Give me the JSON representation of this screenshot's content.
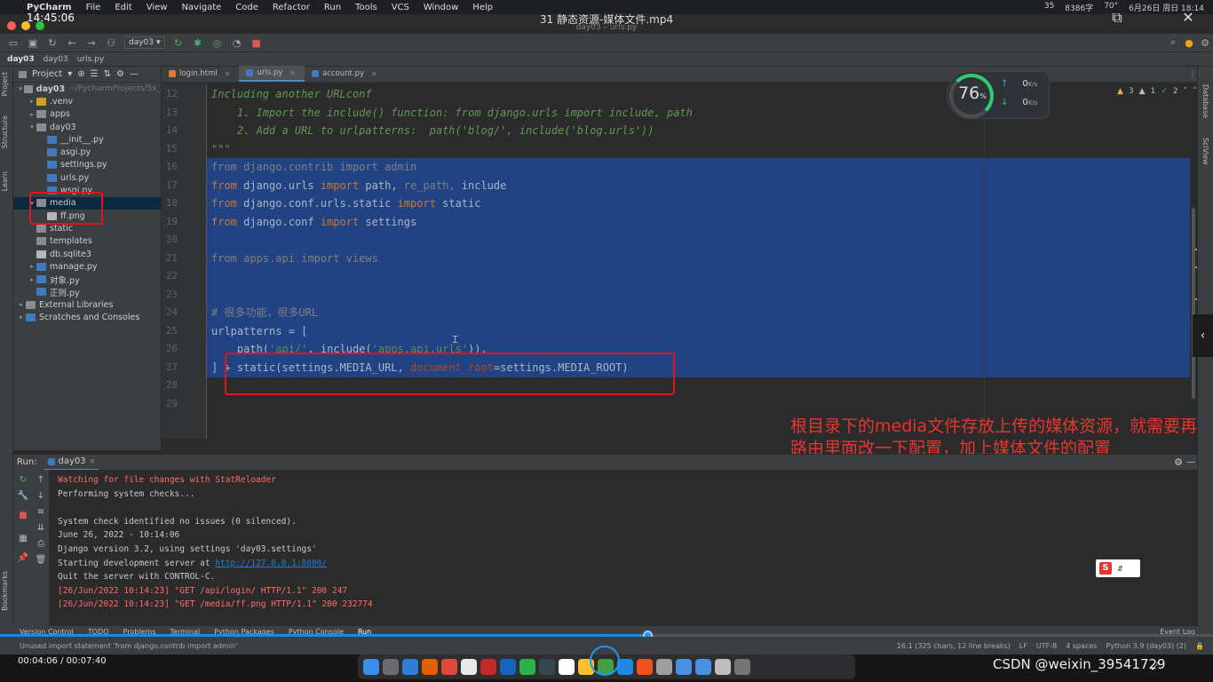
{
  "mac_menu": {
    "app": "PyCharm",
    "items": [
      "File",
      "Edit",
      "View",
      "Navigate",
      "Code",
      "Refactor",
      "Run",
      "Tools",
      "VCS",
      "Window",
      "Help"
    ],
    "status": [
      "35",
      "8386字",
      "70°",
      "6月26日 周日 18:14"
    ]
  },
  "video": {
    "clock": "14:45:06",
    "title": "31 静态资源-媒体文件.mp4",
    "window_title": "day03 – urls.py"
  },
  "toolbar": {
    "run_config": "day03"
  },
  "breadcrumbs": {
    "project": "day03",
    "folder": "day03",
    "file": "urls.py"
  },
  "side_labels": {
    "left": [
      "Project",
      "Structure",
      "Learn",
      "Bookmarks"
    ],
    "right": [
      "Database",
      "SciView"
    ]
  },
  "project_panel": {
    "title": "Project",
    "tree": [
      {
        "indent": 0,
        "arrow": "▾",
        "icon": "folder",
        "label": "day03",
        "extra": "~/PycharmProjects/5x_",
        "bold": true
      },
      {
        "indent": 1,
        "arrow": "▸",
        "icon": "folder-y",
        "label": ".venv"
      },
      {
        "indent": 1,
        "arrow": "▸",
        "icon": "folder",
        "label": "apps"
      },
      {
        "indent": 1,
        "arrow": "▾",
        "icon": "folder",
        "label": "day03"
      },
      {
        "indent": 2,
        "arrow": "",
        "icon": "py",
        "label": "__init__.py"
      },
      {
        "indent": 2,
        "arrow": "",
        "icon": "py",
        "label": "asgi.py"
      },
      {
        "indent": 2,
        "arrow": "",
        "icon": "py",
        "label": "settings.py"
      },
      {
        "indent": 2,
        "arrow": "",
        "icon": "py",
        "label": "urls.py"
      },
      {
        "indent": 2,
        "arrow": "",
        "icon": "py",
        "label": "wsgi.py"
      },
      {
        "indent": 1,
        "arrow": "▾",
        "icon": "folder",
        "label": "media",
        "selected": true
      },
      {
        "indent": 2,
        "arrow": "",
        "icon": "img",
        "label": "ff.png"
      },
      {
        "indent": 1,
        "arrow": "",
        "icon": "folder",
        "label": "static"
      },
      {
        "indent": 1,
        "arrow": "",
        "icon": "folder",
        "label": "templates"
      },
      {
        "indent": 1,
        "arrow": "",
        "icon": "db",
        "label": "db.sqlite3"
      },
      {
        "indent": 1,
        "arrow": "▸",
        "icon": "py",
        "label": "manage.py"
      },
      {
        "indent": 1,
        "arrow": "▸",
        "icon": "py",
        "label": "对象.py"
      },
      {
        "indent": 1,
        "arrow": "",
        "icon": "py",
        "label": "正则.py"
      },
      {
        "indent": 0,
        "arrow": "▸",
        "icon": "lib",
        "label": "External Libraries"
      },
      {
        "indent": 0,
        "arrow": "▸",
        "icon": "scratch",
        "label": "Scratches and Consoles"
      }
    ]
  },
  "editor_tabs": [
    {
      "label": "login.html",
      "color": "#e37933",
      "active": false
    },
    {
      "label": "urls.py",
      "color": "#3f7bbf",
      "active": true
    },
    {
      "label": "account.py",
      "color": "#3f7bbf",
      "active": false
    }
  ],
  "code_lines": [
    {
      "n": "12",
      "html": "<span class='doc'>Including another URLconf</span>"
    },
    {
      "n": "13",
      "html": "<span class='doc'>    1. Import the include() function: from django.urls import include, path</span>"
    },
    {
      "n": "14",
      "html": "<span class='doc'>    2. Add a URL to urlpatterns:  path('blog/', include('blog.urls'))</span>"
    },
    {
      "n": "15",
      "html": "<span class='doc'>\"\"\"</span>"
    },
    {
      "n": "16",
      "html": "<span class='gray'>from django.contrib import admin</span>"
    },
    {
      "n": "17",
      "html": "<span class='kw'>from</span> django.urls <span class='kw'>import</span> path, <span class='gray'>re_path,</span> include"
    },
    {
      "n": "18",
      "html": "<span class='kw'>from</span> django.conf.urls.static <span class='kw'>import</span> static"
    },
    {
      "n": "19",
      "html": "<span class='kw'>from</span> django.conf <span class='kw'>import</span> settings"
    },
    {
      "n": "20",
      "html": ""
    },
    {
      "n": "21",
      "html": "<span class='gray'>from apps.api import views</span>"
    },
    {
      "n": "22",
      "html": ""
    },
    {
      "n": "23",
      "html": ""
    },
    {
      "n": "24",
      "html": "<span class='cmt'># 很多功能，很多URL</span>"
    },
    {
      "n": "25",
      "html": "urlpatterns = ["
    },
    {
      "n": "26",
      "html": "    path(<span class='str'>'api/'</span>, include(<span class='str'>'apps.api.urls'</span>)),"
    },
    {
      "n": "27",
      "html": "] + static(settings.MEDIA_URL, <span class='named'>document_root</span>=settings.MEDIA_ROOT)"
    },
    {
      "n": "28",
      "html": ""
    },
    {
      "n": "29",
      "html": ""
    }
  ],
  "net_widget": {
    "percent": "76",
    "unit": "%",
    "up": "0",
    "down": "0",
    "speed_unit": "K/s"
  },
  "inspections": {
    "warn": "3",
    "weak": "1",
    "typo": "2"
  },
  "annotation": "根目录下的media文件存放上传的媒体资源，就需要再路由里面改一下配置，加上媒体文件的配置",
  "run": {
    "label": "Run:",
    "tab": "day03",
    "console": [
      {
        "text": "Watching for file changes with StatReloader",
        "cls": "red"
      },
      {
        "text": "Performing system checks...",
        "cls": ""
      },
      {
        "text": "",
        "cls": ""
      },
      {
        "text": "System check identified no issues (0 silenced).",
        "cls": ""
      },
      {
        "text": "June 26, 2022 - 10:14:06",
        "cls": ""
      },
      {
        "text": "Django version 3.2, using settings 'day03.settings'",
        "cls": ""
      },
      {
        "text": "Starting development server at ",
        "cls": "",
        "link": "http://127.0.0.1:8000/"
      },
      {
        "text": "Quit the server with CONTROL-C.",
        "cls": ""
      },
      {
        "text": "[26/Jun/2022 10:14:23] \"GET /api/login/ HTTP/1.1\" 200 247",
        "cls": "red"
      },
      {
        "text": "[26/Jun/2022 10:14:23] \"GET /media/ff.png HTTP/1.1\" 200 232774",
        "cls": "red"
      }
    ]
  },
  "bottom_tabs": [
    "Version Control",
    "TODO",
    "Problems",
    "Terminal",
    "Python Packages",
    "Python Console",
    "Run",
    "Event Log"
  ],
  "status_bar": {
    "message": "Unused import statement 'from django.contrib import admin'",
    "position": "16:1 (325 chars, 12 line breaks)",
    "eol": "LF",
    "encoding": "UTF-8",
    "indent": "4 spaces",
    "interpreter": "Python 3.9 (day03) (2)"
  },
  "player": {
    "time": "00:04:06 / 00:07:40",
    "progress": 0.534,
    "watermark": "CSDN @weixin_39541729"
  }
}
